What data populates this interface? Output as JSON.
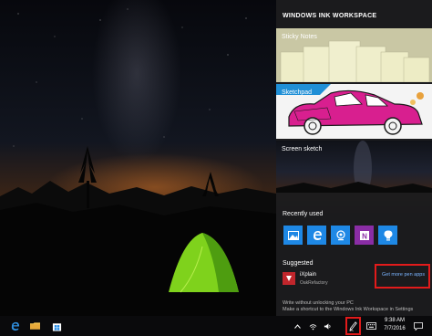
{
  "panel": {
    "title": "WINDOWS INK WORKSPACE",
    "tiles": {
      "sticky_notes": "Sticky Notes",
      "sketchpad": "Sketchpad",
      "screen_sketch": "Screen sketch"
    },
    "recently_used_label": "Recently used",
    "recent_apps": [
      "photos-icon",
      "edge-icon",
      "camera-icon",
      "onenote-icon",
      "tips-icon"
    ],
    "suggested_label": "Suggested",
    "suggested_app": {
      "name": "iXplain",
      "publisher": "OakRefactory",
      "icon": "ixplain-icon"
    },
    "get_more_link": "Get more pen apps",
    "footer_line1": "Write without unlocking your PC",
    "footer_line2": "Make a shortcut to the Windows Ink Workspace in Settings"
  },
  "taskbar": {
    "pinned": [
      "edge-icon",
      "file-explorer-icon",
      "store-icon"
    ],
    "tray": [
      "chevron-up-icon",
      "network-icon",
      "volume-icon",
      "pen-icon",
      "keyboard-icon"
    ],
    "time": "9:38 AM",
    "date": "7/7/2016",
    "notifications_icon": "action-center-icon"
  },
  "colors": {
    "highlight": "#e21b1b",
    "accent": "#1e88e5",
    "panel_bg": "#1c1c1e"
  }
}
